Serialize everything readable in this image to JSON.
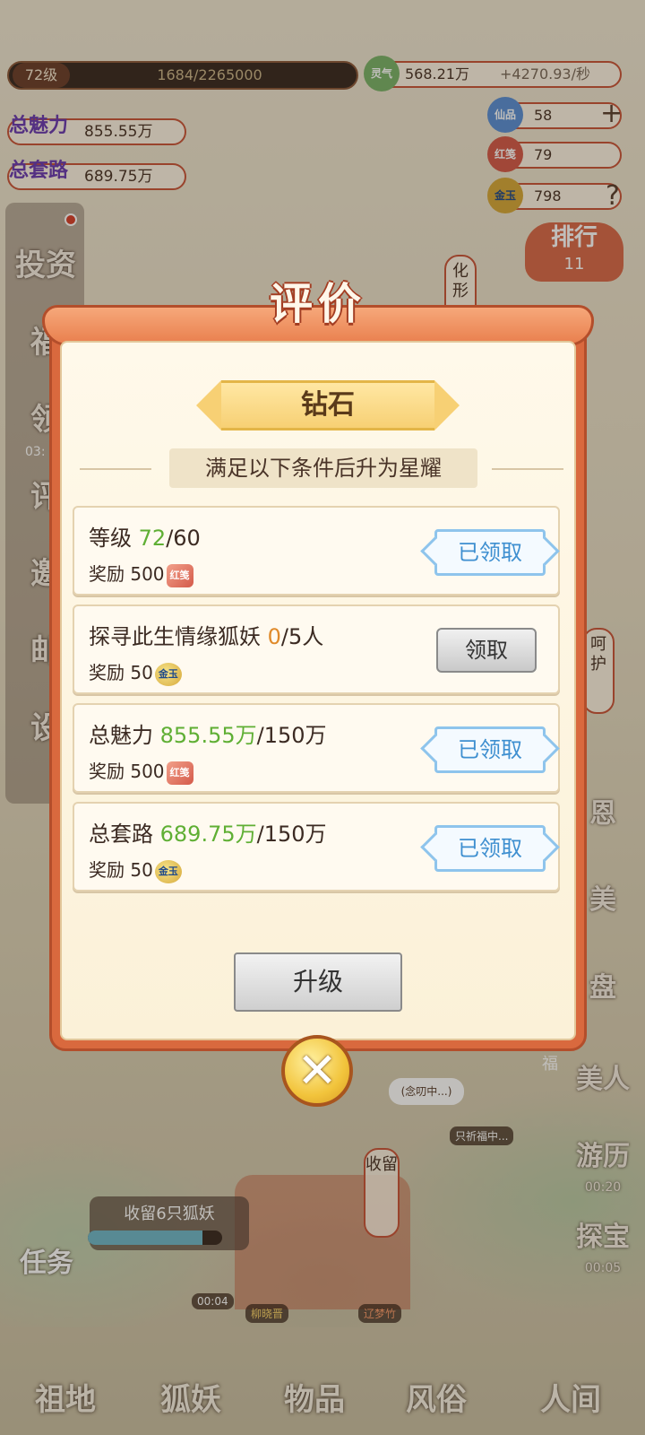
{
  "hud": {
    "level": "72级",
    "exp": "1684/2265000",
    "charm_label": "总魅力",
    "charm": "855.55万",
    "tactics_label": "总套路",
    "tactics": "689.75万",
    "spirit_icon": "灵气",
    "spirit_value": "568.21万",
    "spirit_rate": "+4270.93/秒",
    "xianpin_icon": "仙品",
    "xianpin_value": "58",
    "hongjian_icon": "红笺",
    "hongjian_value": "79",
    "jinyu_icon": "金玉",
    "jinyu_value": "798",
    "rank_label": "排行",
    "rank_value": "11"
  },
  "side_menu": {
    "items": [
      "投资",
      "福",
      "领",
      "评",
      "邀",
      "邮",
      "设"
    ],
    "timer": "03:"
  },
  "right_menu": {
    "huaxing": "化形",
    "hehu": "呵护",
    "en": "恩",
    "mei": "美",
    "pan": "盘",
    "fu": "福",
    "meiren": "美人",
    "youli": "游历",
    "youli_timer": "00:20",
    "tanbao": "探宝",
    "tanbao_timer": "00:05"
  },
  "scene": {
    "speech": "(念叨中...)",
    "blessing": "只祈福中...",
    "shouliu_tag": "收留",
    "timer_small": "00:04",
    "name_tag1": "柳晓晋",
    "name_tag2": "辽梦竹"
  },
  "task": {
    "icon_label": "任务",
    "text": "收留6只狐妖",
    "progress": 0.85
  },
  "nav": {
    "items": [
      "祖地",
      "狐妖",
      "物品",
      "风俗",
      "人间"
    ]
  },
  "dialog": {
    "title": "评价",
    "rank": "钻石",
    "subtitle": "满足以下条件后升为星耀",
    "reward_prefix": "奖励",
    "conditions": [
      {
        "name": "等级 ",
        "current": "72",
        "target": "/60",
        "reward_amount": "500",
        "reward_icon": "红笺",
        "status": "已领取"
      },
      {
        "name": "探寻此生情缘狐妖 ",
        "current": "0",
        "target": "/5人",
        "reward_amount": "50",
        "reward_icon": "金玉",
        "status": "领取"
      },
      {
        "name": "总魅力 ",
        "current": "855.55万",
        "target": "/150万",
        "reward_amount": "500",
        "reward_icon": "红笺",
        "status": "已领取"
      },
      {
        "name": "总套路 ",
        "current": "689.75万",
        "target": "/150万",
        "reward_amount": "50",
        "reward_icon": "金玉",
        "status": "已领取"
      }
    ],
    "upgrade_label": "升级",
    "close_glyph": "✕"
  },
  "colors": {
    "accent": "#d9693e",
    "met_value": "#5faf34",
    "unmet_value": "#e08a2a",
    "claimed": "#3e8fd0"
  }
}
